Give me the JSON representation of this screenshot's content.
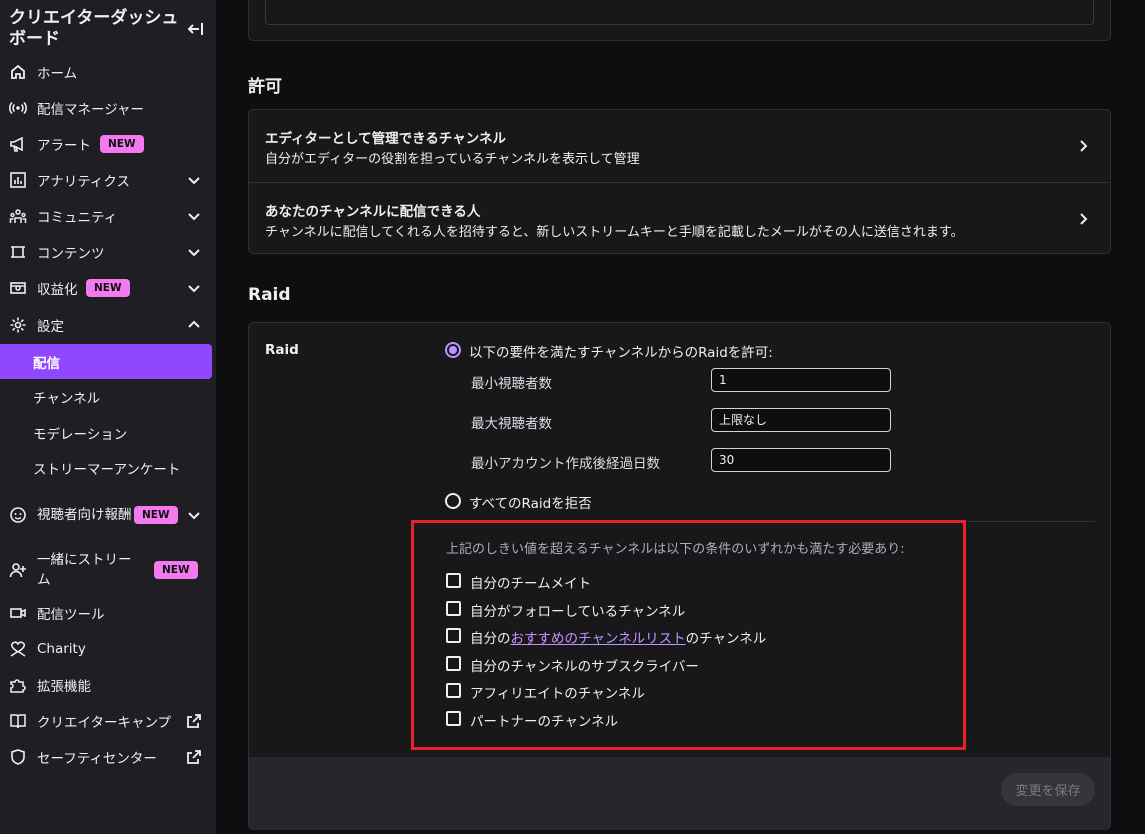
{
  "sidebar": {
    "title": "クリエイターダッシュボード",
    "items": [
      {
        "label": "ホーム",
        "icon": "home-icon"
      },
      {
        "label": "配信マネージャー",
        "icon": "broadcast-icon"
      },
      {
        "label": "アラート",
        "icon": "megaphone-icon",
        "badge": "NEW"
      },
      {
        "label": "アナリティクス",
        "icon": "analytics-icon"
      },
      {
        "label": "コミュニティ",
        "icon": "community-icon"
      },
      {
        "label": "コンテンツ",
        "icon": "content-icon"
      },
      {
        "label": "収益化",
        "icon": "monetization-icon",
        "badge": "NEW"
      },
      {
        "label": "設定",
        "icon": "gear-icon"
      }
    ],
    "settings_sub": [
      {
        "label": "配信",
        "active": true
      },
      {
        "label": "チャンネル"
      },
      {
        "label": "モデレーション"
      },
      {
        "label": "ストリーマーアンケート"
      }
    ],
    "items_after": [
      {
        "label": "視聴者向け報酬",
        "icon": "viewer-rewards-icon",
        "badge": "NEW"
      },
      {
        "label": "一緒にストリーム",
        "icon": "add-user-icon",
        "badge": "NEW"
      },
      {
        "label": "配信ツール",
        "icon": "camera-icon"
      },
      {
        "label": "Charity",
        "icon": "charity-icon"
      },
      {
        "label": "拡張機能",
        "icon": "puzzle-icon"
      },
      {
        "label": "クリエイターキャンプ",
        "icon": "book-icon"
      },
      {
        "label": "セーフティセンター",
        "icon": "shield-icon"
      }
    ]
  },
  "permissions": {
    "title": "許可",
    "rows": [
      {
        "title": "エディターとして管理できるチャンネル",
        "desc": "自分がエディターの役割を担っているチャンネルを表示して管理"
      },
      {
        "title": "あなたのチャンネルに配信できる人",
        "desc": "チャンネルに配信してくれる人を招待すると、新しいストリームキーと手順を記載したメールがその人に送信されます。"
      }
    ]
  },
  "raid": {
    "section_title": "Raid",
    "label": "Raid",
    "option_allow": "以下の要件を満たすチャンネルからのRaidを許可:",
    "option_deny": "すべてのRaidを拒否",
    "fields": [
      {
        "label": "最小視聴者数",
        "value": "1"
      },
      {
        "label": "最大視聴者数",
        "value": "上限なし"
      },
      {
        "label": "最小アカウント作成後経過日数",
        "value": "30"
      }
    ],
    "conditions_text": "上記のしきい値を超えるチャンネルは以下の条件のいずれかも満たす必要あり:",
    "checkboxes": [
      {
        "label": "自分のチームメイト"
      },
      {
        "label": "自分がフォローしているチャンネル"
      },
      {
        "prefix": "自分の",
        "link": "おすすめのチャンネルリスト",
        "suffix": "のチャンネル"
      },
      {
        "label": "自分のチャンネルのサブスクライバー"
      },
      {
        "label": "アフィリエイトのチャンネル"
      },
      {
        "label": "パートナーのチャンネル"
      }
    ],
    "save_label": "変更を保存"
  },
  "colors": {
    "accent": "#9147ff",
    "radio": "#bf94ff",
    "badge": "#f37aee",
    "highlight": "#e5202a"
  }
}
